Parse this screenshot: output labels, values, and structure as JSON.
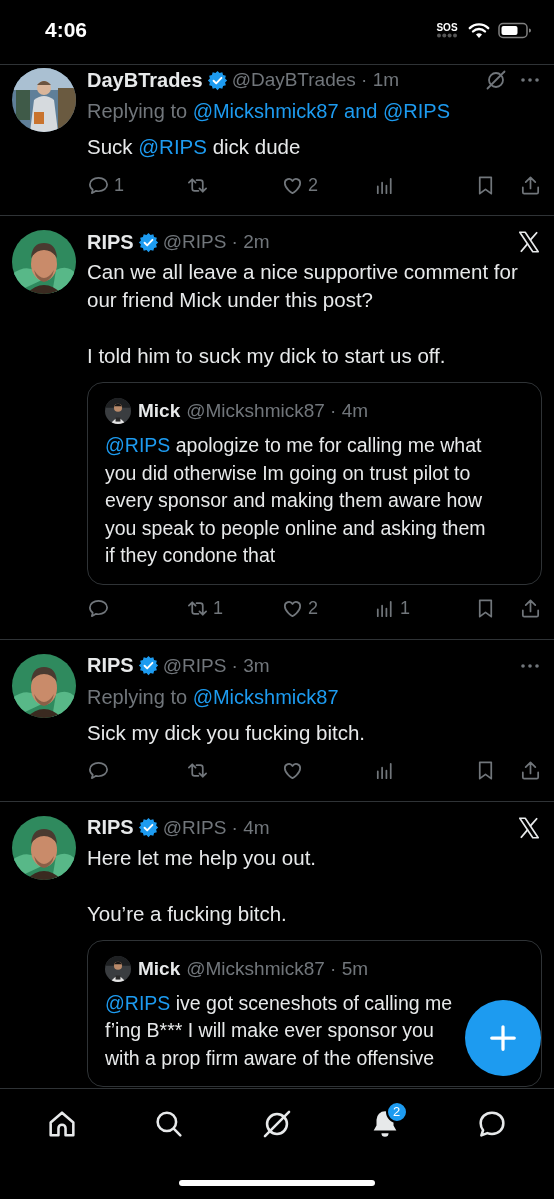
{
  "status_bar": {
    "time": "4:06",
    "sos": "SOS"
  },
  "tweets": [
    {
      "name": "DayBTrades",
      "verified": true,
      "meta": "@DayBTrades · 1m",
      "corner": [
        {
          "kind": "grok"
        },
        {
          "kind": "more"
        }
      ],
      "replying": {
        "prefix": "Replying to",
        "targets": "@Mickshmick87 and @RIPS"
      },
      "paragraphs": [
        [
          {
            "kind": "plain",
            "text": "Suck "
          },
          {
            "kind": "mention",
            "text": "@RIPS"
          },
          {
            "kind": "plain",
            "text": " dick dude"
          }
        ]
      ],
      "actions": [
        {
          "kind": "reply",
          "count": "1"
        },
        {
          "kind": "repost"
        },
        {
          "kind": "like",
          "count": "2"
        },
        {
          "kind": "views"
        },
        {
          "kind": "bookmark"
        },
        {
          "kind": "share"
        }
      ]
    },
    {
      "name": "RIPS",
      "verified": true,
      "meta": "@RIPS · 2m",
      "corner": [
        {
          "kind": "xlogo"
        }
      ],
      "paragraphs": [
        [
          {
            "kind": "plain",
            "text": "Can we all leave a nice supportive comment for our friend Mick under this post?"
          }
        ],
        [
          {
            "kind": "plain",
            "text": "I told him to suck my dick to start us off."
          }
        ]
      ],
      "quote": {
        "name": "Mick",
        "meta": "@Mickshmick87 · 4m",
        "lines": [
          [
            {
              "kind": "mention",
              "text": "@RIPS"
            },
            {
              "kind": "plain",
              "text": " apologize to me for calling me what"
            }
          ],
          [
            {
              "kind": "plain",
              "text": "you did otherwise Im going on trust pilot to"
            }
          ],
          [
            {
              "kind": "plain",
              "text": "every sponsor and making them aware how"
            }
          ],
          [
            {
              "kind": "plain",
              "text": "you speak to people online and asking them"
            }
          ],
          [
            {
              "kind": "plain",
              "text": "if they condone that"
            }
          ]
        ]
      },
      "actions": [
        {
          "kind": "reply"
        },
        {
          "kind": "repost",
          "count": "1"
        },
        {
          "kind": "like",
          "count": "2"
        },
        {
          "kind": "views",
          "count": "1"
        },
        {
          "kind": "bookmark"
        },
        {
          "kind": "share"
        }
      ]
    },
    {
      "name": "RIPS",
      "verified": true,
      "meta": "@RIPS · 3m",
      "corner": [
        {
          "kind": "more"
        }
      ],
      "replying": {
        "prefix": "Replying to",
        "targets": "@Mickshmick87"
      },
      "paragraphs": [
        [
          {
            "kind": "plain",
            "text": "Sick my dick you fucking bitch."
          }
        ]
      ],
      "actions": [
        {
          "kind": "reply"
        },
        {
          "kind": "repost"
        },
        {
          "kind": "like"
        },
        {
          "kind": "views"
        },
        {
          "kind": "bookmark"
        },
        {
          "kind": "share"
        }
      ]
    },
    {
      "name": "RIPS",
      "verified": true,
      "meta": "@RIPS · 4m",
      "corner": [
        {
          "kind": "xlogo"
        }
      ],
      "paragraphs": [
        [
          {
            "kind": "plain",
            "text": "Here let me help you out."
          }
        ],
        [
          {
            "kind": "plain",
            "text": "You’re a fucking bitch."
          }
        ]
      ],
      "quote": {
        "name": "Mick",
        "meta": "@Mickshmick87 · 5m",
        "lines": [
          [
            {
              "kind": "mention",
              "text": "@RIPS"
            },
            {
              "kind": "plain",
              "text": " ive got sceneshots of calling me"
            }
          ],
          [
            {
              "kind": "plain",
              "text": "f’ing B*** I will make ever sponsor you"
            }
          ],
          [
            {
              "kind": "plain",
              "text": "with a prop firm aware of the offensive"
            }
          ]
        ]
      }
    }
  ],
  "tab_bar": [
    {
      "kind": "home"
    },
    {
      "kind": "search"
    },
    {
      "kind": "grok"
    },
    {
      "kind": "notifications",
      "badge": "2"
    },
    {
      "kind": "messages"
    }
  ]
}
